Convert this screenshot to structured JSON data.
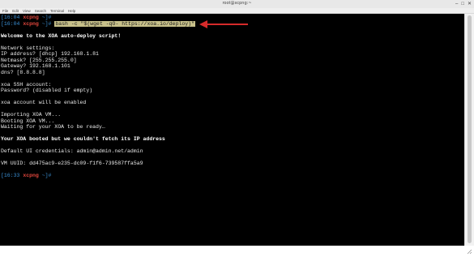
{
  "window": {
    "title": "root@xcpng:~",
    "controls": [
      "minimize-icon",
      "maximize-icon",
      "close-icon"
    ]
  },
  "menu": {
    "items": [
      "File",
      "Edit",
      "View",
      "Search",
      "Terminal",
      "Help"
    ]
  },
  "terminal": {
    "prompt1": {
      "time": "[16:04",
      "host": "xcpng",
      "tail": " ~]#"
    },
    "prompt2": {
      "time": "[16:04",
      "host": "xcpng",
      "tail": " ~]#",
      "command": "bash -c \"$(wget -qO- https://xoa.io/deploy)\""
    },
    "welcome": "Welcome to the XOA auto-deploy script!",
    "network_header": "Network settings:",
    "ip": "IP address? [dhcp] 192.168.1.81",
    "netmask": "Netmask? [255.255.255.0]",
    "gateway": "Gateway? 192.168.1.101",
    "dns": "dns? [8.8.8.8]",
    "ssh_header": "xoa SSH account:",
    "password": "Password? (disabled if empty)",
    "xoa_enabled": "xoa account will be enabled",
    "importing": "Importing XOA VM...",
    "booting": "Booting XOA VM...",
    "waiting": "Waiting for your XOA to be ready…",
    "booted": "Your XOA booted but we couldn't fetch its IP address",
    "credentials": "Default UI credentials: admin@admin.net/admin",
    "uuid": "VM UUID: dd475ac9-e235-dc09-f1f6-739587ffa5a9",
    "prompt3": {
      "time": "[16:33",
      "host": "xcpng",
      "tail": " ~]#"
    }
  },
  "annotation": {
    "arrow_color": "#d62b2b"
  }
}
